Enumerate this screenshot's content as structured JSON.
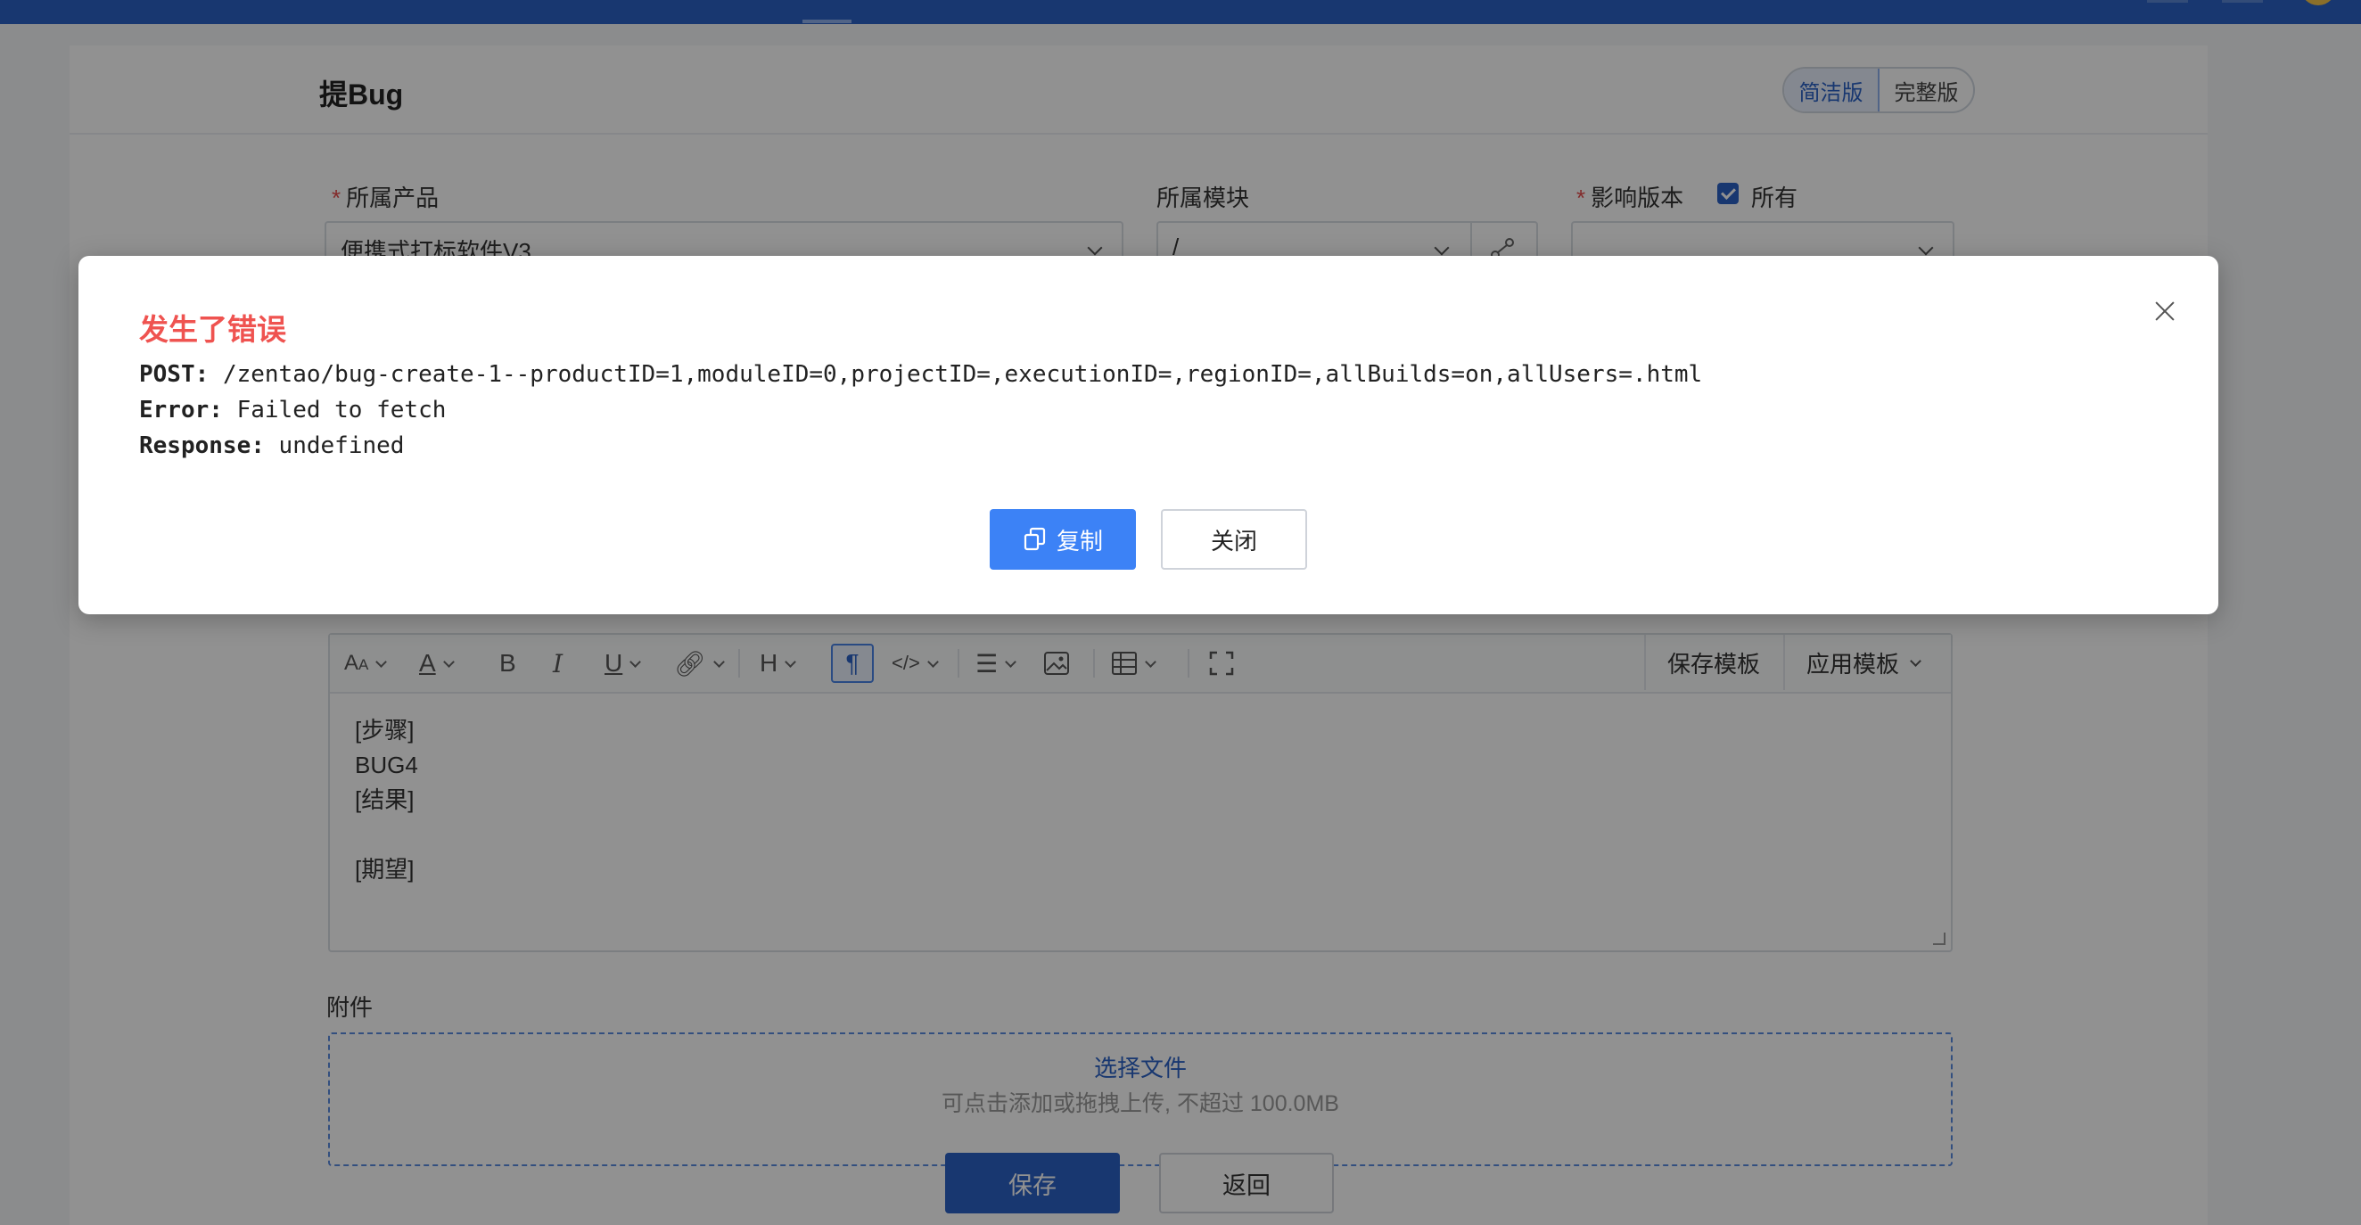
{
  "page": {
    "title": "提Bug"
  },
  "view_toggle": {
    "simple": "简洁版",
    "full": "完整版"
  },
  "form": {
    "product_label": "所属产品",
    "product_value": "便携式打标软件V3",
    "module_label": "所属模块",
    "module_value": "/",
    "version_label": "影响版本",
    "version_all_label": "所有"
  },
  "editor": {
    "toolbar_save_template": "保存模板",
    "toolbar_apply_template": "应用模板",
    "content_lines": [
      "[步骤]",
      "BUG4",
      "[结果]",
      "",
      "[期望]"
    ]
  },
  "attachments": {
    "label": "附件",
    "select_file": "选择文件",
    "hint": "可点击添加或拖拽上传, 不超过 100.0MB"
  },
  "actions": {
    "save": "保存",
    "back": "返回"
  },
  "modal": {
    "title": "发生了错误",
    "post_label": "POST:",
    "post_value": "/zentao/bug-create-1--productID=1,moduleID=0,projectID=,executionID=,regionID=,allBuilds=on,allUsers=.html",
    "error_label": "Error:",
    "error_value": "Failed to fetch",
    "response_label": "Response:",
    "response_value": "undefined",
    "copy_button": "复制",
    "close_button": "关闭"
  },
  "colors": {
    "accent": "#2b62c6",
    "error_title": "#ef5350",
    "copy_button": "#3c82f6"
  }
}
